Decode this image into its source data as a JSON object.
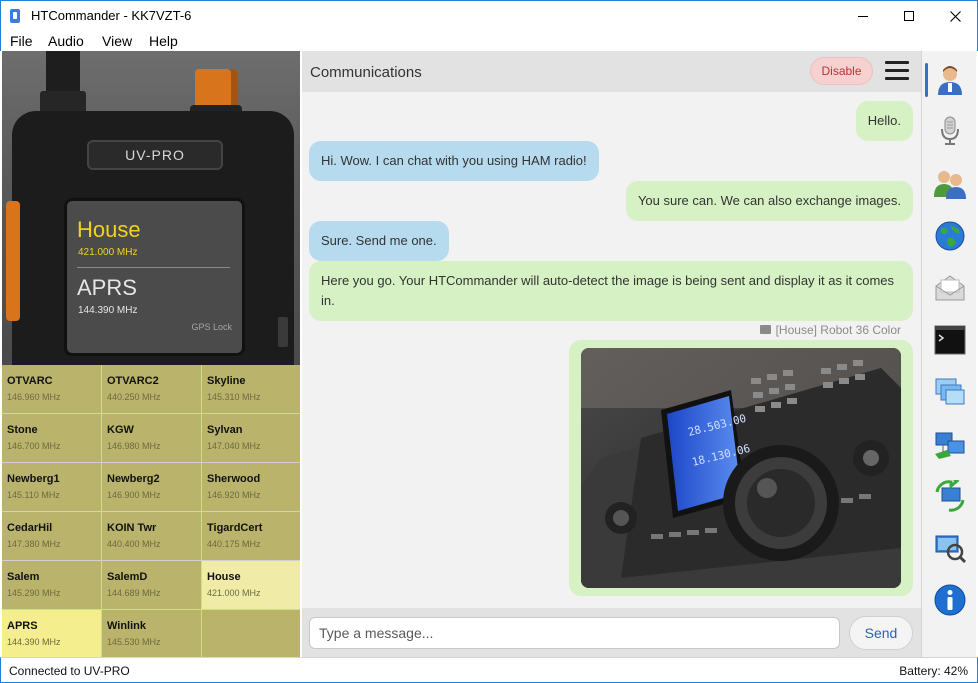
{
  "window": {
    "title": "HTCommander - KK7VZT-6"
  },
  "menu": [
    {
      "label": "File"
    },
    {
      "label": "Audio"
    },
    {
      "label": "View"
    },
    {
      "label": "Help"
    }
  ],
  "radio": {
    "model": "UV-PRO",
    "vfo_a": {
      "name": "House",
      "freq": "421.000 MHz"
    },
    "vfo_b": {
      "name": "APRS",
      "freq": "144.390 MHz"
    },
    "gps_status": "GPS Lock"
  },
  "channels": [
    {
      "name": "OTVARC",
      "freq": "146.960 MHz"
    },
    {
      "name": "OTVARC2",
      "freq": "440.250 MHz"
    },
    {
      "name": "Skyline",
      "freq": "145.310 MHz"
    },
    {
      "name": "Stone",
      "freq": "146.700 MHz"
    },
    {
      "name": "KGW",
      "freq": "146.980 MHz"
    },
    {
      "name": "Sylvan",
      "freq": "147.040 MHz"
    },
    {
      "name": "Newberg1",
      "freq": "145.110 MHz"
    },
    {
      "name": "Newberg2",
      "freq": "146.900 MHz"
    },
    {
      "name": "Sherwood",
      "freq": "146.920 MHz"
    },
    {
      "name": "CedarHil",
      "freq": "147.380 MHz"
    },
    {
      "name": "KOIN Twr",
      "freq": "440.400 MHz"
    },
    {
      "name": "TigardCert",
      "freq": "440.175 MHz"
    },
    {
      "name": "Salem",
      "freq": "145.290 MHz"
    },
    {
      "name": "SalemD",
      "freq": "144.689 MHz"
    },
    {
      "name": "House",
      "freq": "421.000 MHz"
    },
    {
      "name": "APRS",
      "freq": "144.390 MHz"
    },
    {
      "name": "Winlink",
      "freq": "145.530 MHz"
    },
    {
      "name": "",
      "freq": ""
    }
  ],
  "comm": {
    "title": "Communications",
    "disable_label": "Disable",
    "messages": [
      {
        "dir": "out",
        "text": "Hello."
      },
      {
        "dir": "in",
        "text": "Hi. Wow. I can chat with you using HAM radio!"
      },
      {
        "dir": "out",
        "text": "You sure can. We can also exchange images."
      },
      {
        "dir": "in",
        "text": "Sure. Send me one."
      },
      {
        "dir": "out",
        "text": "Here you go. Your HTCommander will auto-detect the image is being sent and display it as it comes in."
      }
    ],
    "image_caption": "[House] Robot 36 Color",
    "input_placeholder": "Type a message...",
    "send_label": "Send"
  },
  "toolbar_icons": [
    "contact-icon",
    "microphone-icon",
    "users-icon",
    "globe-icon",
    "mail-icon",
    "terminal-icon",
    "windows-icon",
    "network-icon",
    "sync-icon",
    "search-icon",
    "info-icon"
  ],
  "status": {
    "left": "Connected to UV-PRO",
    "right": "Battery: 42%"
  }
}
